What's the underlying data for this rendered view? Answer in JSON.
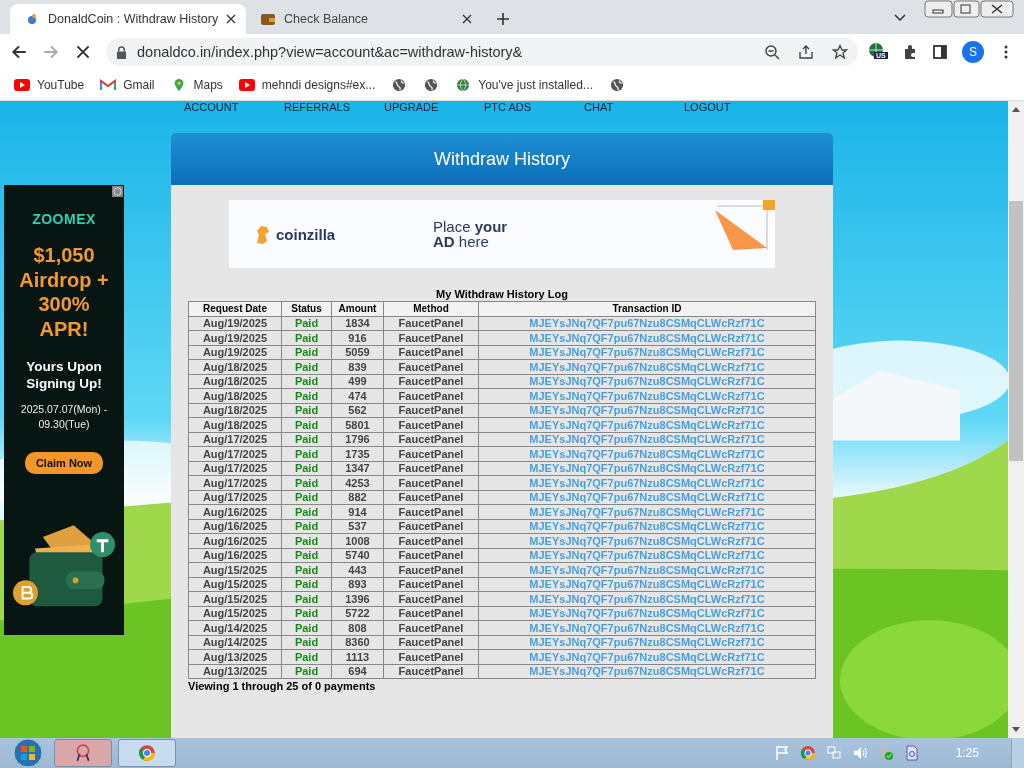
{
  "browser": {
    "tabs": [
      {
        "title": "DonaldCoin : Withdraw History",
        "selected": true,
        "kind": "coin"
      },
      {
        "title": "Check Balance",
        "selected": false,
        "kind": "wallet"
      }
    ],
    "url": "donaldco.in/index.php?view=account&ac=withdraw-history&",
    "profile_initial": "S",
    "extension_badge": "US",
    "bookmarks": [
      {
        "label": "YouTube",
        "kind": "youtube"
      },
      {
        "label": "Gmail",
        "kind": "gmail"
      },
      {
        "label": "Maps",
        "kind": "maps"
      },
      {
        "label": "mehndi designs#ex...",
        "kind": "youtube"
      },
      {
        "kind": "globe"
      },
      {
        "kind": "globe"
      },
      {
        "label": "You've just installed...",
        "kind": "earth"
      },
      {
        "kind": "globe"
      }
    ]
  },
  "nav": [
    "ACCOUNT",
    "REFERRALS",
    "UPGRADE",
    "PTC ADS",
    "CHAT",
    "LOGOUT"
  ],
  "side_ad": {
    "brand": "ZOOMEX",
    "headline": "$1,050 Airdrop + 300% APR!",
    "subhead": "Yours Upon Signing Up!",
    "dates": "2025.07.07(Mon) - 09.30(Tue)",
    "button": "Claim Now"
  },
  "panel": {
    "title": "Withdraw History",
    "banner_ad": {
      "brand": "coinzilla",
      "lines": [
        "Place **your**",
        "**AD** here"
      ]
    },
    "table": {
      "caption": "My Withdraw History Log",
      "columns": [
        "Request Date",
        "Status",
        "Amount",
        "Method",
        "Transaction ID"
      ],
      "rows": [
        [
          "Aug/19/2025",
          "Paid",
          "1834",
          "FaucetPanel",
          "MJEYsJNq7QF7pu67Nzu8CSMqCLWcRzf71C"
        ],
        [
          "Aug/19/2025",
          "Paid",
          "916",
          "FaucetPanel",
          "MJEYsJNq7QF7pu67Nzu8CSMqCLWcRzf71C"
        ],
        [
          "Aug/19/2025",
          "Paid",
          "5059",
          "FaucetPanel",
          "MJEYsJNq7QF7pu67Nzu8CSMqCLWcRzf71C"
        ],
        [
          "Aug/18/2025",
          "Paid",
          "839",
          "FaucetPanel",
          "MJEYsJNq7QF7pu67Nzu8CSMqCLWcRzf71C"
        ],
        [
          "Aug/18/2025",
          "Paid",
          "499",
          "FaucetPanel",
          "MJEYsJNq7QF7pu67Nzu8CSMqCLWcRzf71C"
        ],
        [
          "Aug/18/2025",
          "Paid",
          "474",
          "FaucetPanel",
          "MJEYsJNq7QF7pu67Nzu8CSMqCLWcRzf71C"
        ],
        [
          "Aug/18/2025",
          "Paid",
          "562",
          "FaucetPanel",
          "MJEYsJNq7QF7pu67Nzu8CSMqCLWcRzf71C"
        ],
        [
          "Aug/18/2025",
          "Paid",
          "5801",
          "FaucetPanel",
          "MJEYsJNq7QF7pu67Nzu8CSMqCLWcRzf71C"
        ],
        [
          "Aug/17/2025",
          "Paid",
          "1796",
          "FaucetPanel",
          "MJEYsJNq7QF7pu67Nzu8CSMqCLWcRzf71C"
        ],
        [
          "Aug/17/2025",
          "Paid",
          "1735",
          "FaucetPanel",
          "MJEYsJNq7QF7pu67Nzu8CSMqCLWcRzf71C"
        ],
        [
          "Aug/17/2025",
          "Paid",
          "1347",
          "FaucetPanel",
          "MJEYsJNq7QF7pu67Nzu8CSMqCLWcRzf71C"
        ],
        [
          "Aug/17/2025",
          "Paid",
          "4253",
          "FaucetPanel",
          "MJEYsJNq7QF7pu67Nzu8CSMqCLWcRzf71C"
        ],
        [
          "Aug/17/2025",
          "Paid",
          "882",
          "FaucetPanel",
          "MJEYsJNq7QF7pu67Nzu8CSMqCLWcRzf71C"
        ],
        [
          "Aug/16/2025",
          "Paid",
          "914",
          "FaucetPanel",
          "MJEYsJNq7QF7pu67Nzu8CSMqCLWcRzf71C"
        ],
        [
          "Aug/16/2025",
          "Paid",
          "537",
          "FaucetPanel",
          "MJEYsJNq7QF7pu67Nzu8CSMqCLWcRzf71C"
        ],
        [
          "Aug/16/2025",
          "Paid",
          "1008",
          "FaucetPanel",
          "MJEYsJNq7QF7pu67Nzu8CSMqCLWcRzf71C"
        ],
        [
          "Aug/16/2025",
          "Paid",
          "5740",
          "FaucetPanel",
          "MJEYsJNq7QF7pu67Nzu8CSMqCLWcRzf71C"
        ],
        [
          "Aug/15/2025",
          "Paid",
          "443",
          "FaucetPanel",
          "MJEYsJNq7QF7pu67Nzu8CSMqCLWcRzf71C"
        ],
        [
          "Aug/15/2025",
          "Paid",
          "893",
          "FaucetPanel",
          "MJEYsJNq7QF7pu67Nzu8CSMqCLWcRzf71C"
        ],
        [
          "Aug/15/2025",
          "Paid",
          "1396",
          "FaucetPanel",
          "MJEYsJNq7QF7pu67Nzu8CSMqCLWcRzf71C"
        ],
        [
          "Aug/15/2025",
          "Paid",
          "5722",
          "FaucetPanel",
          "MJEYsJNq7QF7pu67Nzu8CSMqCLWcRzf71C"
        ],
        [
          "Aug/14/2025",
          "Paid",
          "808",
          "FaucetPanel",
          "MJEYsJNq7QF7pu67Nzu8CSMqCLWcRzf71C"
        ],
        [
          "Aug/14/2025",
          "Paid",
          "8360",
          "FaucetPanel",
          "MJEYsJNq7QF7pu67Nzu8CSMqCLWcRzf71C"
        ],
        [
          "Aug/13/2025",
          "Paid",
          "1113",
          "FaucetPanel",
          "MJEYsJNq7QF7pu67Nzu8CSMqCLWcRzf71C"
        ],
        [
          "Aug/13/2025",
          "Paid",
          "694",
          "FaucetPanel",
          "MJEYsJNq7QF7pu67Nzu8CSMqCLWcRzf71C"
        ]
      ],
      "footer": "Viewing 1 through 25 of 0 payments"
    }
  },
  "taskbar": {
    "time": "1:25"
  }
}
